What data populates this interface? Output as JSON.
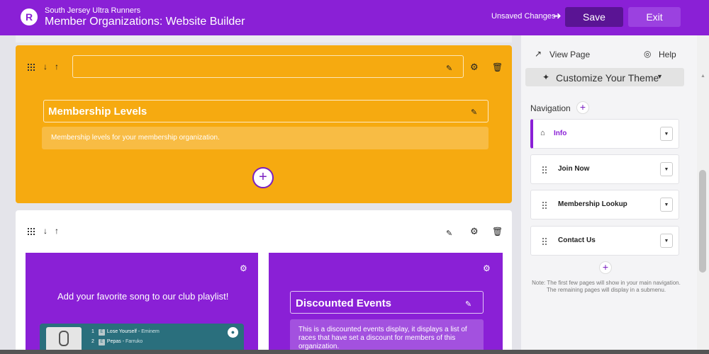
{
  "header": {
    "logo_letter": "R",
    "org_name": "South Jersey Ultra Runners",
    "page_title": "Member Organizations: Website Builder",
    "unsaved_label": "Unsaved Changes",
    "save_label": "Save",
    "exit_label": "Exit",
    "colors": {
      "bar": "#8a20d6",
      "save": "#5a1494",
      "exit": "#9b41e0"
    }
  },
  "sections": [
    {
      "background": "#f6aa10",
      "title_value": "",
      "block": {
        "title": "Membership Levels",
        "description": "Membership levels for your membership organization."
      }
    },
    {
      "background": "#ffffff",
      "title_value": "",
      "cards": [
        {
          "heading": "Add your favorite song to our club playlist!",
          "playlist": [
            {
              "num": "1",
              "explicit": "E",
              "track": "Lose Yourself",
              "artist": "Eminem"
            },
            {
              "num": "2",
              "explicit": "E",
              "track": "Pepas",
              "artist": "Farruko"
            }
          ]
        },
        {
          "title": "Discounted Events",
          "description": "This is a discounted events display, it displays a list of races that have set a discount for members of this organization."
        }
      ]
    }
  ],
  "sidebar": {
    "view_page_label": "View Page",
    "help_label": "Help",
    "theme_button_label": "Customize Your Theme",
    "navigation_label": "Navigation",
    "nav_items": [
      {
        "label": "Info",
        "active": true
      },
      {
        "label": "Join Now",
        "active": false
      },
      {
        "label": "Membership Lookup",
        "active": false
      },
      {
        "label": "Contact Us",
        "active": false
      }
    ],
    "note": "Note: The first few pages will show in your main navigation. The remaining pages will display in a submenu."
  },
  "icons": {
    "drag": "drag-handle-icon",
    "move_down": "arrow-down-icon",
    "move_up": "arrow-up-icon",
    "edit": "edit-icon",
    "settings": "gear-icon",
    "delete": "trash-icon",
    "add": "plus-icon",
    "external": "external-link-icon",
    "help": "lifebuoy-icon",
    "theme": "magic-wand-icon",
    "home": "home-icon",
    "dropdown": "caret-down-icon"
  }
}
